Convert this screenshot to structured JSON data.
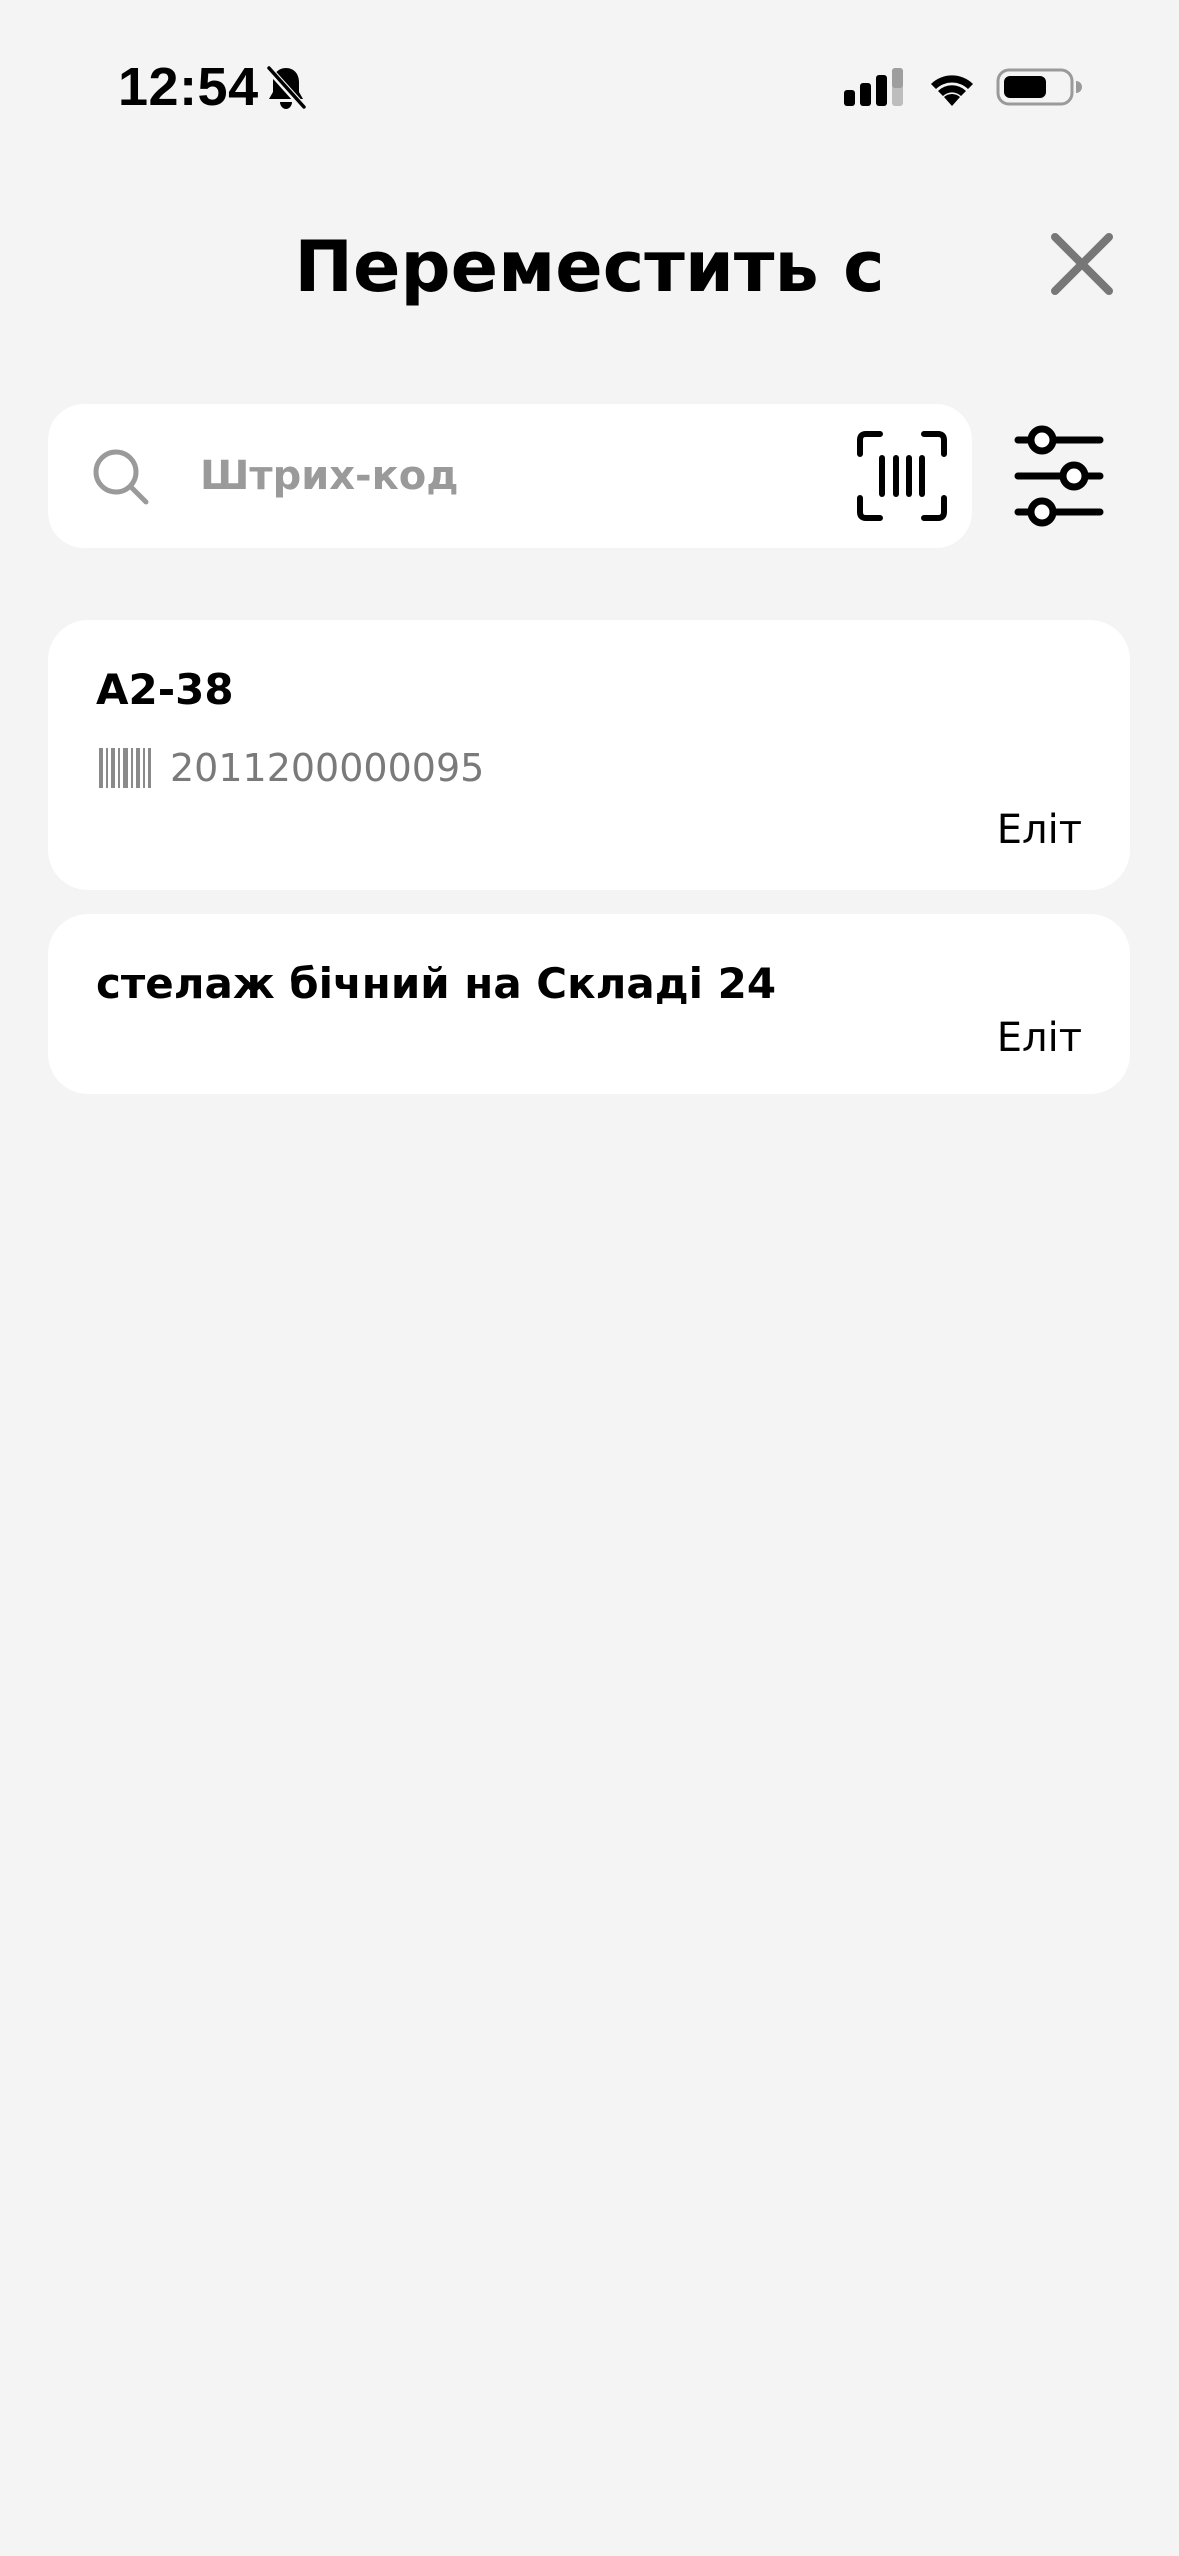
{
  "status_bar": {
    "time": "12:54"
  },
  "icons": {
    "bell": "bell-slash-icon",
    "signal": "cellular-signal-icon",
    "wifi": "wifi-icon",
    "battery": "battery-icon",
    "close": "close-icon",
    "search": "search-icon",
    "scan": "barcode-scan-icon",
    "filter": "sliders-filter-icon",
    "barcode": "barcode-icon"
  },
  "colors": {
    "background": "#f4f4f4",
    "card": "#ffffff",
    "close_icon": "#7a7a7a",
    "placeholder": "#9a9a9a",
    "muted_text": "#7a7a7a"
  },
  "header": {
    "title": "Переместить с"
  },
  "search": {
    "placeholder": "Штрих-код",
    "value": ""
  },
  "locations": [
    {
      "name": "А2-38",
      "barcode": "2011200000095",
      "owner": "Еліт"
    },
    {
      "name": "стелаж бічний на Складі 24",
      "owner": "Еліт"
    }
  ]
}
